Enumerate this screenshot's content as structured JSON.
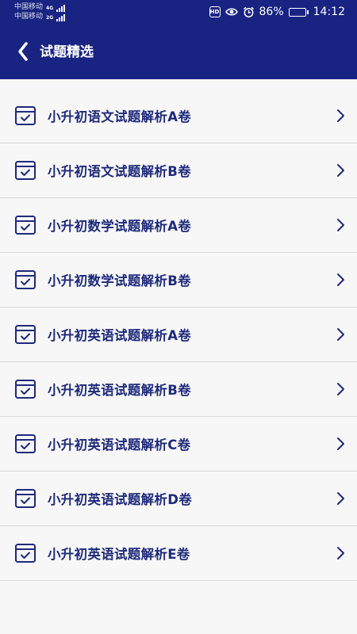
{
  "status_bar": {
    "carrier_1": "中国移动",
    "carrier_1_network": "4G",
    "carrier_2": "中国移动",
    "carrier_2_network": "2G",
    "hd_label": "HD",
    "battery_percent": "86%",
    "battery_level": 0.86,
    "time": "14:12"
  },
  "header": {
    "title": "试题精选",
    "background_color": "#182382"
  },
  "list": {
    "items": [
      {
        "label": "小升初语文试题解析A卷"
      },
      {
        "label": "小升初语文试题解析B卷"
      },
      {
        "label": "小升初数学试题解析A卷"
      },
      {
        "label": "小升初数学试题解析B卷"
      },
      {
        "label": "小升初英语试题解析A卷"
      },
      {
        "label": "小升初英语试题解析B卷"
      },
      {
        "label": "小升初英语试题解析C卷"
      },
      {
        "label": "小升初英语试题解析D卷"
      },
      {
        "label": "小升初英语试题解析E卷"
      }
    ],
    "item_icon": "checked-document-icon",
    "trailing_icon": "chevron-right-icon",
    "accent_color": "#1e2a7a"
  }
}
